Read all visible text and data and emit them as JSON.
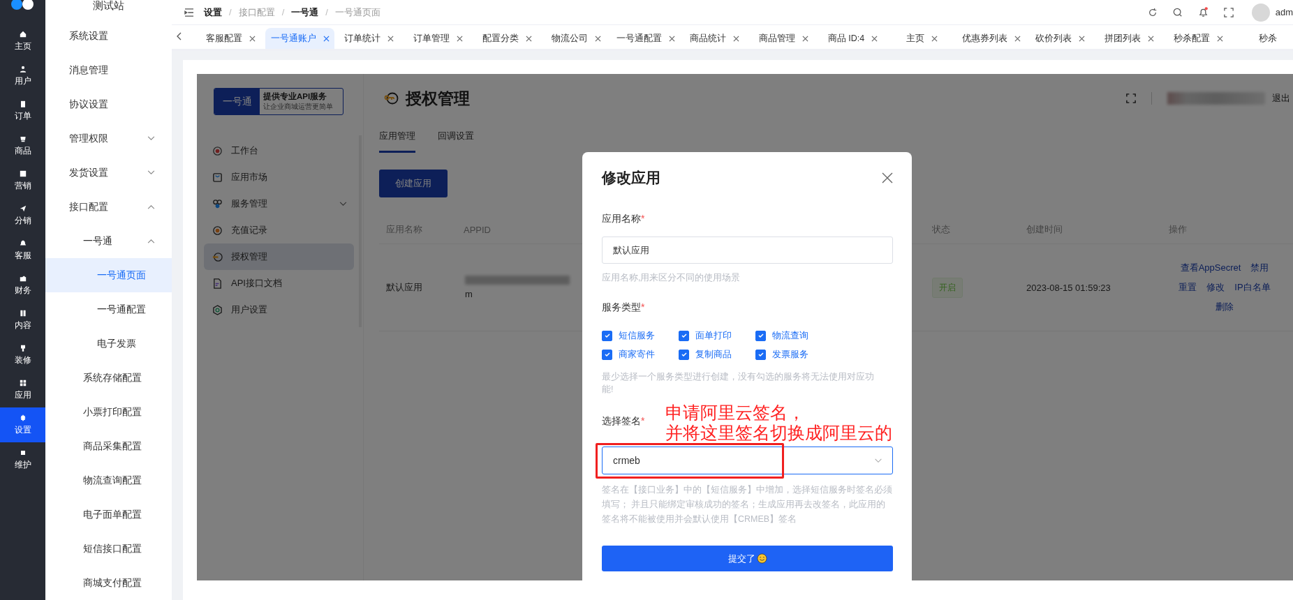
{
  "rail": {
    "items": [
      {
        "label": "主页",
        "selected": false
      },
      {
        "label": "用户",
        "selected": false
      },
      {
        "label": "订单",
        "selected": false
      },
      {
        "label": "商品",
        "selected": false
      },
      {
        "label": "营销",
        "selected": false
      },
      {
        "label": "分销",
        "selected": false
      },
      {
        "label": "客服",
        "selected": false
      },
      {
        "label": "财务",
        "selected": false
      },
      {
        "label": "内容",
        "selected": false
      },
      {
        "label": "装修",
        "selected": false
      },
      {
        "label": "应用",
        "selected": false
      },
      {
        "label": "设置",
        "selected": true
      },
      {
        "label": "维护",
        "selected": false
      }
    ]
  },
  "site_title": "测试站",
  "menu": [
    {
      "label": "系统设置",
      "selected": false
    },
    {
      "label": "消息管理",
      "selected": false
    },
    {
      "label": "协议设置",
      "selected": false
    },
    {
      "label": "管理权限",
      "selected": false,
      "expanded": false
    },
    {
      "label": "发货设置",
      "selected": false,
      "expanded": false
    },
    {
      "label": "接口配置",
      "selected": false,
      "expanded": true,
      "children": [
        {
          "label": "一号通",
          "selected": false,
          "expanded": true,
          "children": [
            {
              "label": "一号通页面",
              "selected": true
            },
            {
              "label": "一号通配置",
              "selected": false
            },
            {
              "label": "电子发票",
              "selected": false
            }
          ]
        },
        {
          "label": "系统存储配置",
          "selected": false
        },
        {
          "label": "小票打印配置",
          "selected": false
        },
        {
          "label": "商品采集配置",
          "selected": false
        },
        {
          "label": "物流查询配置",
          "selected": false
        },
        {
          "label": "电子面单配置",
          "selected": false
        },
        {
          "label": "短信接口配置",
          "selected": false
        },
        {
          "label": "商城支付配置",
          "selected": false
        }
      ]
    }
  ],
  "breadcrumb_separator": "/",
  "breadcrumb": [
    {
      "label": "设置",
      "current": true
    },
    {
      "label": "接口配置",
      "current": false
    },
    {
      "label": "一号通",
      "current": true
    },
    {
      "label": "一号通页面",
      "current": false
    }
  ],
  "user": {
    "name": "adm"
  },
  "tabs": [
    {
      "label": "客服配置",
      "selected": false,
      "closable": true
    },
    {
      "label": "一号通账户",
      "selected": true,
      "closable": true
    },
    {
      "label": "订单统计",
      "selected": false,
      "closable": true
    },
    {
      "label": "订单管理",
      "selected": false,
      "closable": true
    },
    {
      "label": "配置分类",
      "selected": false,
      "closable": true
    },
    {
      "label": "物流公司",
      "selected": false,
      "closable": true
    },
    {
      "label": "一号通配置",
      "selected": false,
      "closable": true
    },
    {
      "label": "商品统计",
      "selected": false,
      "closable": true
    },
    {
      "label": "商品管理",
      "selected": false,
      "closable": true
    },
    {
      "label": "商品 ID:4",
      "selected": false,
      "closable": true
    },
    {
      "label": "主页",
      "selected": false,
      "closable": true
    },
    {
      "label": "优惠券列表",
      "selected": false,
      "closable": true
    },
    {
      "label": "砍价列表",
      "selected": false,
      "closable": true
    },
    {
      "label": "拼团列表",
      "selected": false,
      "closable": true
    },
    {
      "label": "秒杀配置",
      "selected": false,
      "closable": true
    },
    {
      "label": "秒杀",
      "selected": false,
      "closable": false
    }
  ],
  "panel": {
    "logo": {
      "mark": "一号通",
      "title": "提供专业API服务",
      "subtitle": "让企业商城运营更简单"
    },
    "menu": [
      {
        "label": "工作台",
        "selected": false
      },
      {
        "label": "应用市场",
        "selected": false
      },
      {
        "label": "服务管理",
        "selected": false,
        "expanded": false
      },
      {
        "label": "充值记录",
        "selected": false
      },
      {
        "label": "授权管理",
        "selected": true
      },
      {
        "label": "API接口文档",
        "selected": false
      },
      {
        "label": "用户设置",
        "selected": false
      }
    ],
    "title": "授权管理",
    "logout": "退出",
    "tabs": [
      {
        "label": "应用管理",
        "selected": true
      },
      {
        "label": "回调设置",
        "selected": false
      }
    ],
    "create_button": "创建应用",
    "table": {
      "columns": [
        "应用名称",
        "APPID",
        "状态",
        "创建时间",
        "操作"
      ],
      "rows": [
        {
          "name": "默认应用",
          "appid_tail": "m",
          "status": "开启",
          "enabled": true,
          "created": "2023-08-15 01:59:23",
          "actions": [
            "查看AppSecret",
            "禁用",
            "重置",
            "修改",
            "IP白名单",
            "删除"
          ]
        }
      ]
    }
  },
  "dialog": {
    "title": "修改应用",
    "required_mark": "*",
    "name_label": "应用名称",
    "name_value": "默认应用",
    "name_hint": "应用名称,用来区分不同的使用场景",
    "services_label": "服务类型",
    "services": [
      {
        "label": "短信服务",
        "checked": true
      },
      {
        "label": "面单打印",
        "checked": true
      },
      {
        "label": "物流查询",
        "checked": true
      },
      {
        "label": "商家寄件",
        "checked": true
      },
      {
        "label": "复制商品",
        "checked": true
      },
      {
        "label": "发票服务",
        "checked": true
      }
    ],
    "services_hint": "最少选择一个服务类型进行创建，没有勾选的服务将无法使用对应功能!",
    "sign_label": "选择签名",
    "sign_value": "crmeb",
    "sign_hint": "签名在【接口业务】中的【短信服务】中增加，选择短信服务时签名必须填写； 并且只能绑定审核成功的签名；生成应用再去改签名，此应用的签名将不能被使用并会默认使用【CRMEB】签名",
    "submit": "提交了"
  },
  "annotation": {
    "lines": [
      "申请阿里云签名，",
      "并将这里签名切换成阿里云的"
    ]
  }
}
